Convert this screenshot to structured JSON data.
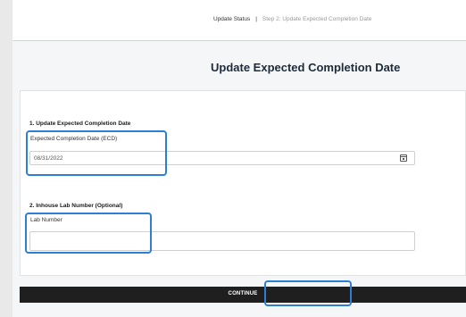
{
  "breadcrumb": {
    "current": "Update Status",
    "separator": "|",
    "step": "Step 2: Update Expected Completion Date"
  },
  "page_title": "Update Expected Completion Date",
  "section_ecd": {
    "heading": "1. Update Expected Completion Date",
    "field_label": "Expected Completion Date (ECD)",
    "value": "08/31/2022",
    "icon": "calendar-icon"
  },
  "section_lab": {
    "heading": "2. Inhouse Lab Number (Optional)",
    "field_label": "Lab Number",
    "value": ""
  },
  "continue_button": {
    "label": "CONTINUE"
  },
  "colors": {
    "highlight": "#2d7fd3",
    "button_bg": "#1f1f1f",
    "title": "#1e2b3a"
  }
}
